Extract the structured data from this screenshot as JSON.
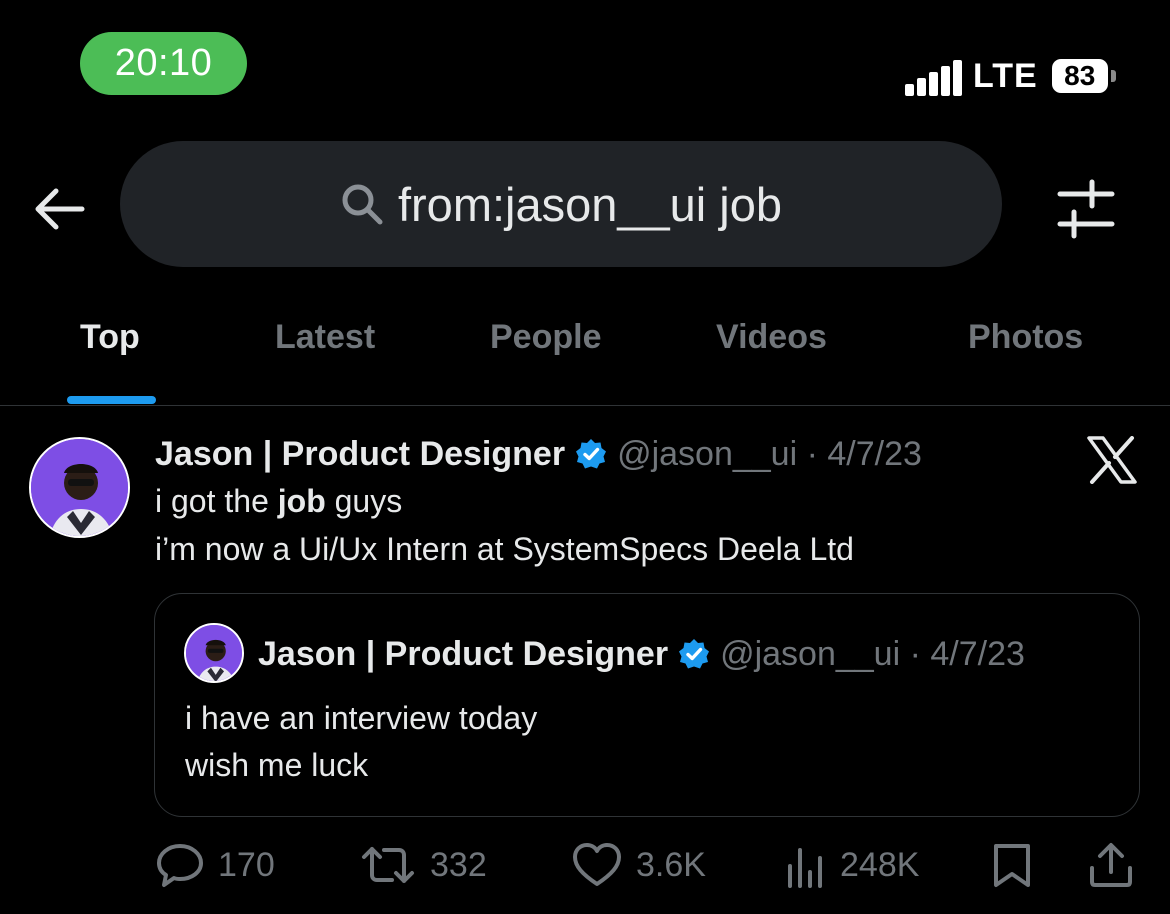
{
  "status_bar": {
    "time": "20:10",
    "network": "LTE",
    "battery": "83"
  },
  "search": {
    "query": "from:jason__ui job"
  },
  "tabs": [
    {
      "label": "Top",
      "active": true
    },
    {
      "label": "Latest",
      "active": false
    },
    {
      "label": "People",
      "active": false
    },
    {
      "label": "Videos",
      "active": false
    },
    {
      "label": "Photos",
      "active": false
    }
  ],
  "post": {
    "author_name": "Jason | Product Designer",
    "handle_date": "@jason__ui · 4/7/23",
    "line1_pre": "i got the ",
    "line1_bold": "job",
    "line1_post": " guys",
    "line2": "i’m now a Ui/Ux Intern at SystemSpecs Deela Ltd",
    "quote": {
      "author_name": "Jason | Product Designer",
      "handle_date": "@jason__ui · 4/7/23",
      "line1": "i have an interview today",
      "line2": "wish me luck"
    },
    "actions": {
      "replies": "170",
      "reposts": "332",
      "likes": "3.6K",
      "views": "248K"
    }
  },
  "colors": {
    "accent": "#1d9bf0",
    "time_pill": "#4cbd56",
    "avatar_bg": "#7e4ee5",
    "muted_text": "#71767b"
  },
  "icons": [
    "back-arrow-icon",
    "search-icon",
    "filter-sliders-icon",
    "verified-badge-icon",
    "x-logo-icon",
    "reply-icon",
    "repost-icon",
    "like-icon",
    "views-icon",
    "bookmark-icon",
    "share-icon"
  ]
}
